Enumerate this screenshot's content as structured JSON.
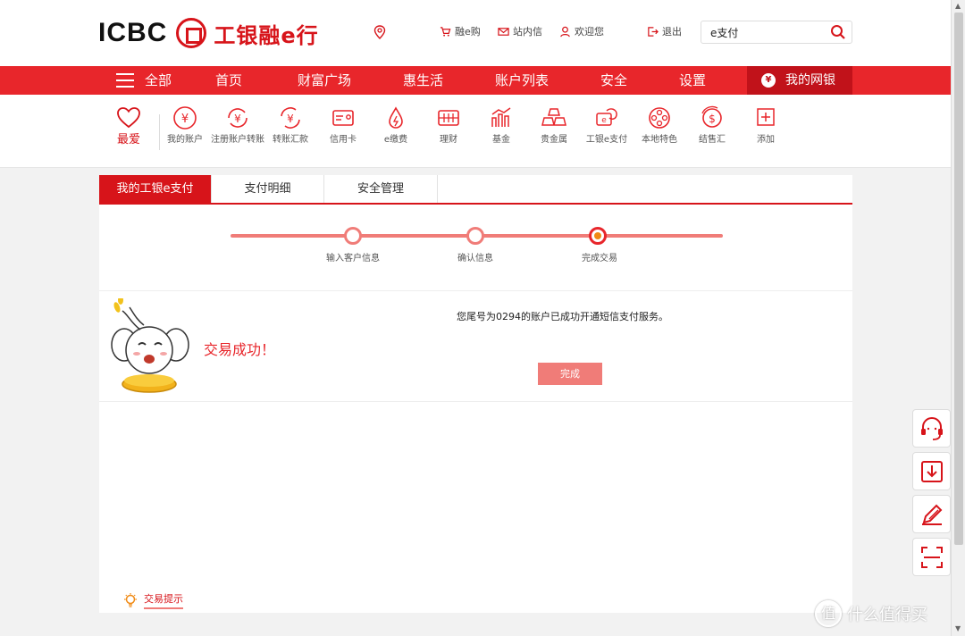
{
  "header": {
    "logo_en": "ICBC",
    "logo_cn": "工银融e行",
    "nav": [
      {
        "label": "融e购",
        "icon": "cart-icon"
      },
      {
        "label": "站内信",
        "icon": "mail-icon"
      },
      {
        "label": "欢迎您",
        "icon": "user-icon"
      },
      {
        "label": "退出",
        "icon": "logout-icon"
      }
    ],
    "search_value": "e支付"
  },
  "main_nav": {
    "all": "全部",
    "items": [
      "首页",
      "财富广场",
      "惠生活",
      "账户列表",
      "安全",
      "设置"
    ],
    "my_bank": "我的网银"
  },
  "quick_menu": {
    "favorite": "最爱",
    "items": [
      {
        "label": "我的账户",
        "icon": "yuan-circle-icon"
      },
      {
        "label": "注册账户转账",
        "icon": "yuan-transfer-icon"
      },
      {
        "label": "转账汇款",
        "icon": "yuan-remit-icon"
      },
      {
        "label": "信用卡",
        "icon": "credit-card-icon"
      },
      {
        "label": "e缴费",
        "icon": "drop-icon"
      },
      {
        "label": "理财",
        "icon": "wealth-icon"
      },
      {
        "label": "基金",
        "icon": "fund-chart-icon"
      },
      {
        "label": "贵金属",
        "icon": "gold-bars-icon"
      },
      {
        "label": "工银e支付",
        "icon": "epay-icon"
      },
      {
        "label": "本地特色",
        "icon": "film-reel-icon"
      },
      {
        "label": "结售汇",
        "icon": "dollar-icon"
      },
      {
        "label": "添加",
        "icon": "add-icon"
      }
    ]
  },
  "tabs": [
    "我的工银e支付",
    "支付明细",
    "安全管理"
  ],
  "steps": [
    "输入客户信息",
    "确认信息",
    "完成交易"
  ],
  "result": {
    "title": "交易成功！",
    "message": "您尾号为0294的账户已成功开通短信支付服务。",
    "done_label": "完成"
  },
  "tip_label": "交易提示",
  "watermark": "什么值得买",
  "colors": {
    "brand_red": "#e8262b",
    "dark_red": "#c1121a",
    "soft_red": "#f07c78"
  }
}
